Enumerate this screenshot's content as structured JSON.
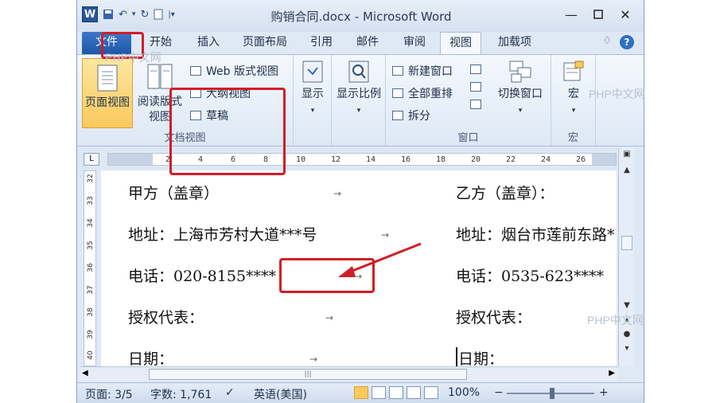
{
  "window": {
    "app_letter": "W",
    "title": "购销合同.docx - Microsoft Word"
  },
  "tabs": [
    "文件",
    "开始",
    "插入",
    "页面布局",
    "引用",
    "邮件",
    "审阅",
    "视图",
    "加载项"
  ],
  "ribbon": {
    "doc_views": {
      "print_layout": "页面视图",
      "reading_layout_l1": "阅读版式",
      "reading_layout_l2": "视图",
      "web_layout": "Web 版式视图",
      "outline": "大纲视图",
      "draft": "草稿",
      "group_label": "文档视图"
    },
    "show": "显示",
    "zoom": "显示比例",
    "window": {
      "new_window": "新建窗口",
      "arrange_all": "全部重排",
      "split": "拆分",
      "switch": "切换窗口",
      "group_label": "窗口"
    },
    "macros": {
      "label": "宏",
      "group_label": "宏"
    }
  },
  "ruler": {
    "ticks": [
      "2",
      "4",
      "6",
      "8",
      "10",
      "12",
      "14",
      "16",
      "18",
      "20",
      "22",
      "24",
      "26"
    ]
  },
  "vruler": {
    "ticks": [
      "32",
      "33",
      "34",
      "35",
      "36",
      "37",
      "38",
      "39",
      "40"
    ]
  },
  "document": {
    "left": [
      "甲方（盖章）",
      "地址：上海市芳村大道***号",
      "电话：020-8155****",
      "授权代表：",
      "日期："
    ],
    "right": [
      "乙方（盖章）：",
      "地址：烟台市莲前东路*",
      "电话：0535-623****",
      "授权代表：",
      "日期："
    ],
    "tab_mark": "→"
  },
  "status": {
    "page": "页面: 3/5",
    "words": "字数: 1,761",
    "language": "英语(美国)",
    "zoom": "100%"
  },
  "watermark": "PHP中文网",
  "colors": {
    "file_tab": "#2a63b6",
    "highlight": "#f9c95c",
    "annotation": "#d21d26"
  }
}
